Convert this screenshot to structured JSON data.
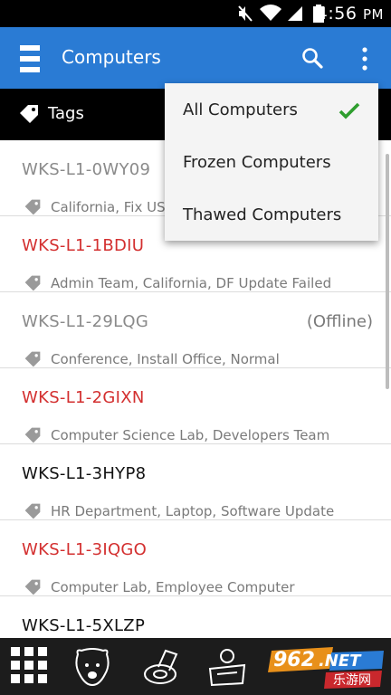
{
  "status_bar": {
    "time": "4:56",
    "period": "PM"
  },
  "app_bar": {
    "title": "Computers",
    "icons": [
      "menu-icon",
      "search-icon",
      "more-vert-icon"
    ]
  },
  "tags_bar": {
    "label": "Tags"
  },
  "dropdown": {
    "items": [
      {
        "label": "All Computers",
        "selected": true
      },
      {
        "label": "Frozen Computers",
        "selected": false
      },
      {
        "label": "Thawed Computers",
        "selected": false
      }
    ]
  },
  "computers": [
    {
      "name": "WKS-L1-0WY09",
      "tags": "California, Fix US",
      "status": "",
      "state": "gray"
    },
    {
      "name": "WKS-L1-1BDIU",
      "tags": "Admin Team, California, DF Update Failed",
      "status": "",
      "state": "red"
    },
    {
      "name": "WKS-L1-29LQG",
      "tags": "Conference, Install Office, Normal",
      "status": "(Offline)",
      "state": "gray"
    },
    {
      "name": "WKS-L1-2GIXN",
      "tags": "Computer Science Lab, Developers Team",
      "status": "",
      "state": "red"
    },
    {
      "name": "WKS-L1-3HYP8",
      "tags": "HR Department, Laptop, Software Update",
      "status": "",
      "state": "black"
    },
    {
      "name": "WKS-L1-3IQGO",
      "tags": "Computer Lab, Employee Computer",
      "status": "",
      "state": "red"
    },
    {
      "name": "WKS-L1-5XLZP",
      "tags": "",
      "status": "",
      "state": "black"
    }
  ],
  "colors": {
    "app_bar": "#2a7bd4",
    "red_text": "#d32f2f",
    "check": "#2e9e2e"
  },
  "bottom_bar": {
    "icons": [
      "grid-icon",
      "bear-icon",
      "disc-icon",
      "shield-user-icon"
    ]
  },
  "watermark": {
    "number": "962",
    "suffix": ".NET",
    "sub": "乐游网"
  }
}
